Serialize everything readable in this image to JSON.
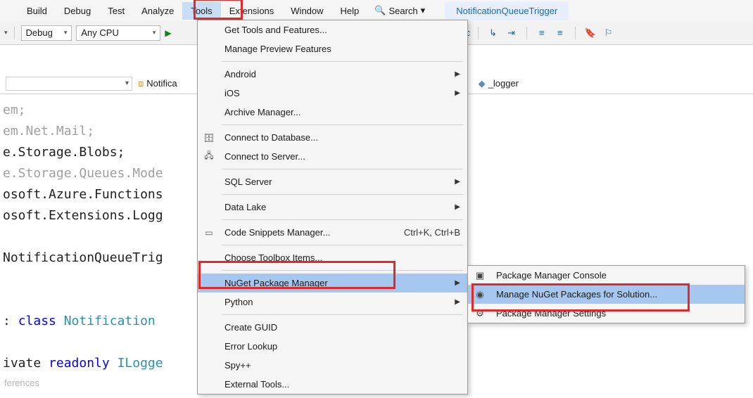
{
  "menubar": {
    "items": [
      "Build",
      "Debug",
      "Test",
      "Analyze",
      "Tools",
      "Extensions",
      "Window",
      "Help"
    ],
    "search_label": "Search",
    "open_tab": "NotificationQueueTrigger"
  },
  "toolbar": {
    "config_dropdown": "Debug",
    "platform_dropdown": "Any CPU"
  },
  "navbar": {
    "breadcrumb1": "Notifica",
    "breadcrumb2": "_logger"
  },
  "code": {
    "l1": "em;",
    "l2": "em.Net.Mail;",
    "l3": "e.Storage.Blobs;",
    "l4": "e.Storage.Queues.Mode",
    "l5": "osoft.Azure.Functions",
    "l6": "osoft.Extensions.Logg",
    "l7": "",
    "l8": "NotificationQueueTrig",
    "l9": "",
    "l10": "",
    "l11a": ": ",
    "l11b": "class",
    "l11c": " ",
    "l11d": "Notification",
    "l12": "",
    "l13a": "ivate ",
    "l13b": "readonly",
    "l13c": " ",
    "l13d": "ILogge"
  },
  "tools_menu": [
    {
      "label": "Get Tools and Features...",
      "type": "item"
    },
    {
      "label": "Manage Preview Features",
      "type": "item"
    },
    {
      "type": "sep"
    },
    {
      "label": "Android",
      "type": "sub"
    },
    {
      "label": "iOS",
      "type": "sub"
    },
    {
      "label": "Archive Manager...",
      "type": "item"
    },
    {
      "type": "sep"
    },
    {
      "label": "Connect to Database...",
      "type": "item",
      "icon": "db"
    },
    {
      "label": "Connect to Server...",
      "type": "item",
      "icon": "server"
    },
    {
      "type": "sep"
    },
    {
      "label": "SQL Server",
      "type": "sub"
    },
    {
      "type": "sep"
    },
    {
      "label": "Data Lake",
      "type": "sub"
    },
    {
      "type": "sep"
    },
    {
      "label": "Code Snippets Manager...",
      "type": "item",
      "shortcut": "Ctrl+K, Ctrl+B",
      "icon": "snippet"
    },
    {
      "type": "sep"
    },
    {
      "label": "Choose Toolbox Items...",
      "type": "item"
    },
    {
      "type": "sep"
    },
    {
      "label": "NuGet Package Manager",
      "type": "sub",
      "hovered": true
    },
    {
      "label": "Python",
      "type": "sub"
    },
    {
      "type": "sep"
    },
    {
      "label": "Create GUID",
      "type": "item"
    },
    {
      "label": "Error Lookup",
      "type": "item"
    },
    {
      "label": "Spy++",
      "type": "item"
    },
    {
      "label": "External Tools...",
      "type": "item"
    }
  ],
  "nuget_submenu": [
    {
      "label": "Package Manager Console",
      "icon": "console"
    },
    {
      "label": "Manage NuGet Packages for Solution...",
      "icon": "package",
      "hovered": true
    },
    {
      "label": "Package Manager Settings",
      "icon": "gear"
    }
  ],
  "footer": "ferences"
}
